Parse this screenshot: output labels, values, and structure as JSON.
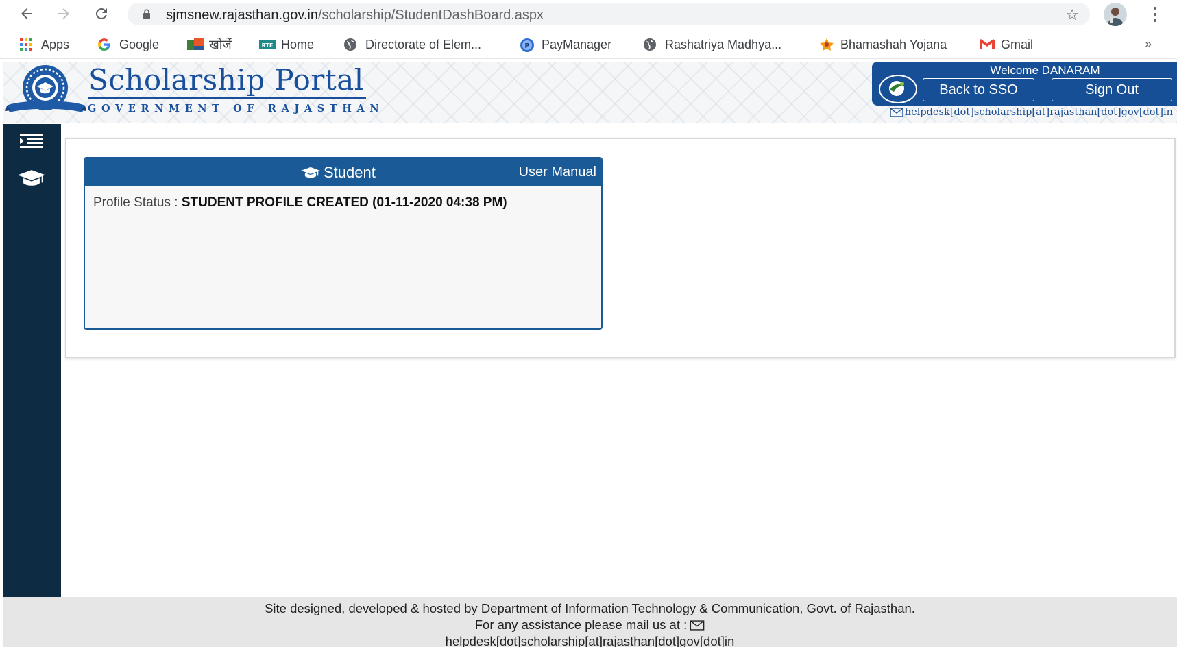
{
  "browser": {
    "url_host": "sjmsnew.rajasthan.gov.in",
    "url_path": "/scholarship/StudentDashBoard.aspx",
    "bookmarks": [
      {
        "label": "Apps",
        "icon": "apps-grid-icon"
      },
      {
        "label": "Google",
        "icon": "google-g-icon"
      },
      {
        "label": "खोजें",
        "icon": "bookmark-site-icon"
      },
      {
        "label": "Home",
        "icon": "rte-icon"
      },
      {
        "label": "Directorate of Elem...",
        "icon": "globe-icon"
      },
      {
        "label": "PayManager",
        "icon": "paymanager-icon"
      },
      {
        "label": "Rashatriya Madhya...",
        "icon": "globe-icon"
      },
      {
        "label": "Bhamashah Yojana",
        "icon": "bhamashah-icon"
      },
      {
        "label": "Gmail",
        "icon": "gmail-icon"
      }
    ],
    "more_label": "»"
  },
  "header": {
    "title": "Scholarship Portal",
    "subtitle": "GOVERNMENT OF RAJASTHAN",
    "logo_text": "SCHOLARSHIP",
    "welcome": "Welcome DANARAM",
    "back_to_sso": "Back to SSO",
    "sign_out": "Sign Out",
    "helpdesk": "helpdesk[dot]scholarship[at]rajasthan[dot]gov[dot]in"
  },
  "card": {
    "title": "Student",
    "user_manual": "User Manual",
    "status_label": "Profile Status : ",
    "status_value": "STUDENT PROFILE CREATED (01-11-2020 04:38 PM)"
  },
  "footer": {
    "line1": "Site designed, developed & hosted by Department of Information Technology & Communication, Govt. of Rajasthan.",
    "line2": "For any assistance please mail us at :",
    "line3": "helpdesk[dot]scholarship[at]rajasthan[dot]gov[dot]in"
  },
  "colors": {
    "brand_blue": "#1a5a96",
    "sidebar_navy": "#0d2b43",
    "footer_gray": "#e6e6e6"
  }
}
